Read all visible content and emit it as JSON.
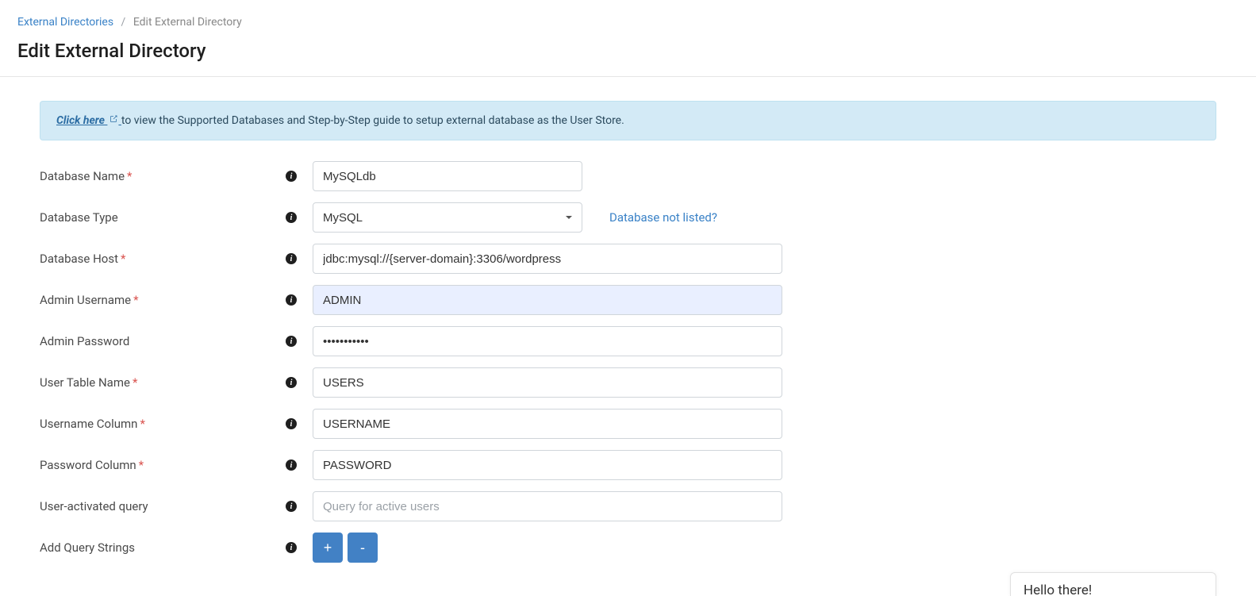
{
  "breadcrumb": {
    "parent": "External Directories",
    "current": "Edit External Directory"
  },
  "page_title": "Edit External Directory",
  "alert": {
    "link_text": "Click here",
    "rest": "to view the Supported Databases and Step-by-Step guide to setup external database as the User Store."
  },
  "labels": {
    "db_name": "Database Name",
    "db_type": "Database Type",
    "db_host": "Database Host",
    "admin_user": "Admin Username",
    "admin_pass": "Admin Password",
    "user_table": "User Table Name",
    "user_col": "Username Column",
    "pass_col": "Password Column",
    "active_q": "User-activated query",
    "add_qs": "Add Query Strings"
  },
  "values": {
    "db_name": "MySQLdb",
    "db_type": "MySQL",
    "db_host": "jdbc:mysql://{server-domain}:3306/wordpress",
    "admin_user": "ADMIN",
    "admin_pass": "•••••••••••",
    "user_table": "USERS",
    "user_col": "USERNAME",
    "pass_col": "PASSWORD",
    "active_q": ""
  },
  "placeholders": {
    "active_q": "Query for active users"
  },
  "select_options": {
    "db_type": [
      "MySQL"
    ]
  },
  "links": {
    "db_not_listed": "Database not listed?"
  },
  "buttons": {
    "plus": "+",
    "minus": "-"
  },
  "chat": {
    "greeting": "Hello there!"
  }
}
